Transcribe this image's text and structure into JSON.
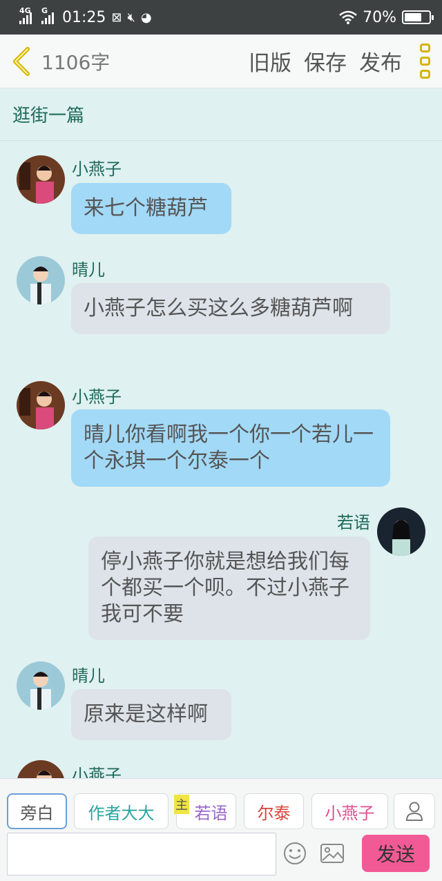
{
  "statusbar": {
    "network1": "4G",
    "network2": "G",
    "time": "01:25",
    "battery": "70%",
    "battery_level": 0.7
  },
  "header": {
    "word_count": "1106字",
    "actions": [
      "旧版",
      "保存",
      "发布"
    ]
  },
  "chapter_title": "逛街一篇",
  "messages": [
    {
      "speaker": "小燕子",
      "text": "来七个糖葫芦"
    },
    {
      "speaker": "晴儿",
      "text": "小燕子怎么买这么多糖葫芦啊"
    },
    {
      "speaker": "小燕子",
      "text": "晴儿你看啊我一个你一个若儿一个永琪一个尔泰一个"
    },
    {
      "speaker": "若语",
      "text": "停小燕子你就是想给我们每个都买一个呗。不过小燕子我可不要"
    },
    {
      "speaker": "晴儿",
      "text": "原来是这样啊"
    },
    {
      "speaker": "小燕子",
      "text": ""
    }
  ],
  "role_chips": [
    {
      "label": "旁白",
      "color": "#555555"
    },
    {
      "label": "作者大大",
      "color": "#2aa5a0"
    },
    {
      "label": "若语",
      "color": "#9a68c8",
      "tag": "主"
    },
    {
      "label": "尔泰",
      "color": "#d9443a"
    },
    {
      "label": "小燕子",
      "color": "#e0508f"
    }
  ],
  "composer": {
    "input_value": "",
    "send_label": "发送"
  }
}
